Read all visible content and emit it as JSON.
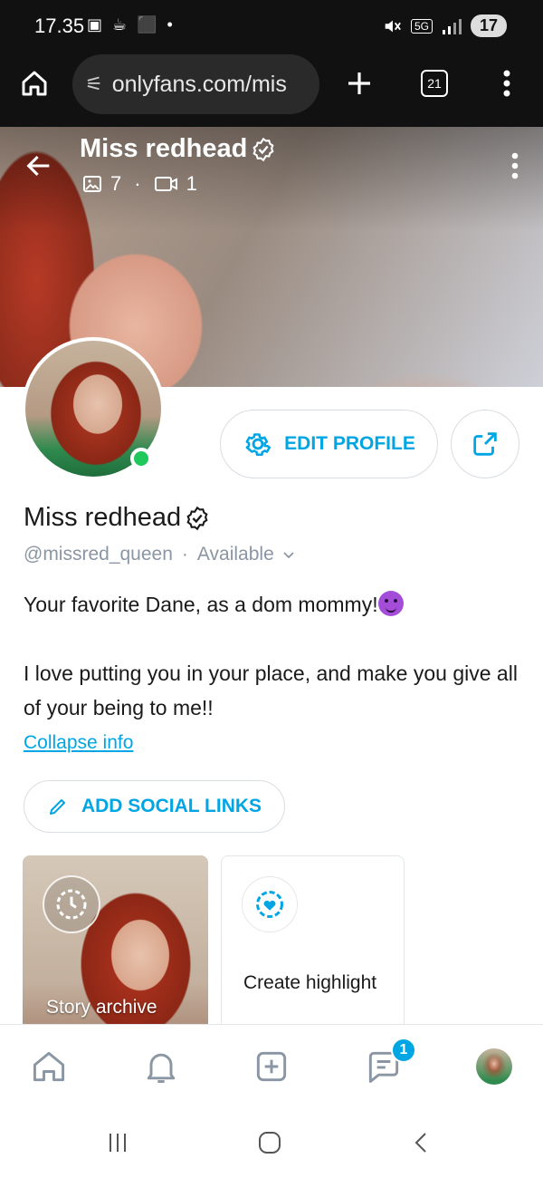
{
  "status_bar": {
    "time": "17.35",
    "notification_icons": "▣ ☕ ⬛ •",
    "network_label": "5G",
    "battery": "17"
  },
  "browser": {
    "url": "onlyfans.com/mis",
    "tabs_count": "21"
  },
  "cover": {
    "title": "Miss redhead",
    "photos_count": "7",
    "videos_count": "1",
    "separator": "·"
  },
  "profile": {
    "edit_button_label": "EDIT PROFILE",
    "display_name": "Miss redhead",
    "handle": "@missred_queen",
    "separator": "·",
    "status": "Available",
    "bio_line1": "Your favorite Dane, as a dom mommy!",
    "bio_line2": "I love putting you in your place, and make you give all of your being to me!!",
    "collapse_link": "Collapse info",
    "social_button_label": "ADD SOCIAL LINKS"
  },
  "highlights": {
    "story_archive_label": "Story archive",
    "create_highlight_label": "Create highlight"
  },
  "bottom_nav": {
    "messages_badge": "1"
  },
  "colors": {
    "accent": "#00a6e4",
    "online": "#1ec85a",
    "muted_text": "#8a96a3"
  }
}
